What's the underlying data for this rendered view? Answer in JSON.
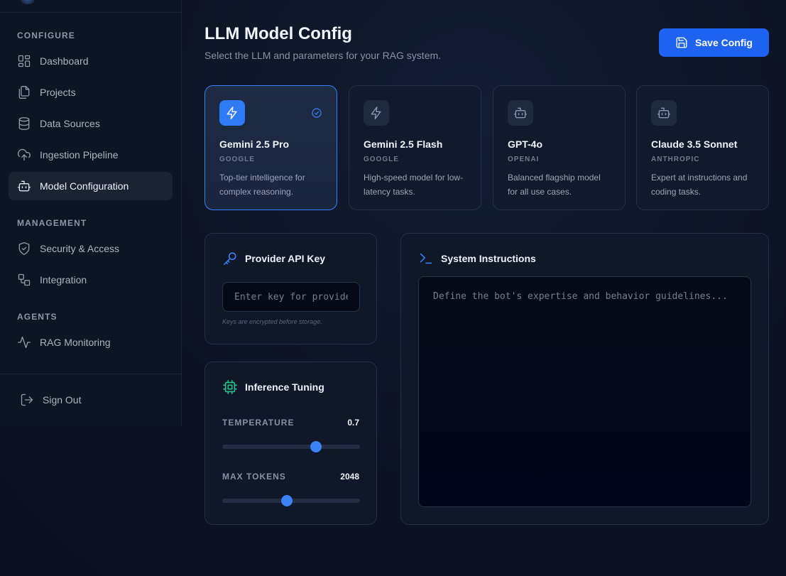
{
  "sidebar": {
    "sections": {
      "configure": "CONFIGURE",
      "management": "MANAGEMENT",
      "agents": "AGENTS"
    },
    "items": [
      {
        "label": "Dashboard",
        "icon": "dashboard-icon"
      },
      {
        "label": "Projects",
        "icon": "projects-icon"
      },
      {
        "label": "Data Sources",
        "icon": "database-icon"
      },
      {
        "label": "Ingestion Pipeline",
        "icon": "cloud-upload-icon"
      },
      {
        "label": "Model Configuration",
        "icon": "bot-icon",
        "active": true
      },
      {
        "label": "Security & Access",
        "icon": "shield-icon"
      },
      {
        "label": "Integration",
        "icon": "integration-icon"
      },
      {
        "label": "RAG Monitoring",
        "icon": "activity-icon"
      }
    ],
    "sign_out": "Sign Out"
  },
  "header": {
    "title": "LLM Model Config",
    "subtitle": "Select the LLM and parameters for your RAG system.",
    "save_label": "Save Config"
  },
  "models": [
    {
      "name": "Gemini 2.5 Pro",
      "provider": "GOOGLE",
      "desc": "Top-tier intelligence for complex reasoning.",
      "icon": "bolt-icon",
      "selected": true
    },
    {
      "name": "Gemini 2.5 Flash",
      "provider": "GOOGLE",
      "desc": "High-speed model for low-latency tasks.",
      "icon": "bolt-icon"
    },
    {
      "name": "GPT-4o",
      "provider": "OPENAI",
      "desc": "Balanced flagship model for all use cases.",
      "icon": "bot-icon"
    },
    {
      "name": "Claude 3.5 Sonnet",
      "provider": "ANTHROPIC",
      "desc": "Expert at instructions and coding tasks.",
      "icon": "bot-icon"
    }
  ],
  "api_key": {
    "title": "Provider API Key",
    "placeholder": "Enter key for provider...",
    "hint": "Keys are encrypted before storage."
  },
  "tuning": {
    "title": "Inference Tuning",
    "temperature": {
      "label": "TEMPERATURE",
      "value": "0.7",
      "fraction": 0.68
    },
    "max_tokens": {
      "label": "MAX TOKENS",
      "value": "2048",
      "fraction": 0.47
    }
  },
  "system": {
    "title": "System Instructions",
    "placeholder": "Define the bot's expertise and behavior guidelines..."
  },
  "colors": {
    "accent": "#3a82f6",
    "primary_button": "#1d63f0",
    "chip_icon": "#22c58b"
  }
}
